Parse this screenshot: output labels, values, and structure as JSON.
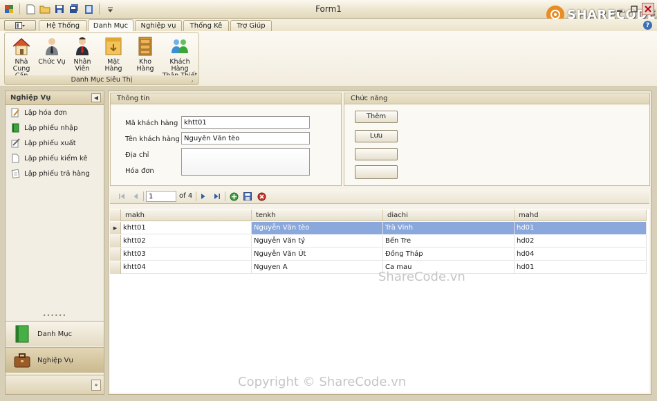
{
  "window": {
    "title": "Form1"
  },
  "menu_tabs": [
    {
      "label": "Hệ Thống"
    },
    {
      "label": "Danh Mục"
    },
    {
      "label": "Nghiệp vụ"
    },
    {
      "label": "Thống Kê"
    },
    {
      "label": "Trợ Giúp"
    }
  ],
  "active_tab": "Danh Mục",
  "ribbon": {
    "group_label": "Danh Mục Siêu Thị",
    "buttons": [
      {
        "label_line1": "Nhà Cung",
        "label_line2": "Cấp"
      },
      {
        "label_line1": "Chức Vụ",
        "label_line2": ""
      },
      {
        "label_line1": "Nhân Viên",
        "label_line2": ""
      },
      {
        "label_line1": "Mặt Hàng",
        "label_line2": ""
      },
      {
        "label_line1": "Kho Hàng",
        "label_line2": ""
      },
      {
        "label_line1": "Khách Hàng",
        "label_line2": "Thân Thiết"
      }
    ]
  },
  "nav": {
    "header": "Nghiệp Vụ",
    "items": [
      {
        "label": "Lập hóa đơn"
      },
      {
        "label": "Lập phiếu nhập"
      },
      {
        "label": "Lập phiếu xuất"
      },
      {
        "label": "Lập phiếu kiểm kê"
      },
      {
        "label": "Lập phiếu trả hàng"
      }
    ],
    "big_buttons": [
      {
        "label": "Danh Mục"
      },
      {
        "label": "Nghiệp Vụ"
      }
    ]
  },
  "info_panel": {
    "title": "Thông tin",
    "fields": [
      {
        "label": "Mã khách hàng",
        "value": "khtt01"
      },
      {
        "label": "Tên khách hàng",
        "value": "Nguyễn Văn tèo"
      },
      {
        "label": "Địa chỉ",
        "value": ""
      },
      {
        "label": "Hóa đơn",
        "value": ""
      }
    ]
  },
  "function_panel": {
    "title": "Chức năng",
    "buttons": [
      {
        "label": "Thêm"
      },
      {
        "label": "Lưu"
      },
      {
        "label": ""
      },
      {
        "label": ""
      }
    ]
  },
  "binding_navigator": {
    "position": "1",
    "count_text": "of 4"
  },
  "grid": {
    "columns": [
      "makh",
      "tenkh",
      "diachi",
      "mahd"
    ],
    "rows": [
      [
        "khtt01",
        "Nguyễn Văn tèo",
        "Trà Vinh",
        "hd01"
      ],
      [
        "khtt02",
        "Nguyễn Văn tý",
        "Bến Tre",
        "hd02"
      ],
      [
        "khtt03",
        "Nguyễn Văn Út",
        "Đồng Tháp",
        "hd04"
      ],
      [
        "khtt04",
        "Nguyen A",
        "Ca mau",
        "hd01"
      ]
    ],
    "selected_row": 0
  },
  "watermarks": {
    "logo": "SHARECODE.vn",
    "center": "ShareCode.vn",
    "bottom": "Copyright © ShareCode.vn"
  },
  "colors": {
    "selection": "#8aa8dc",
    "ribbon_bg": "#f2ecdd",
    "frame_bg": "#d8cfb8"
  }
}
